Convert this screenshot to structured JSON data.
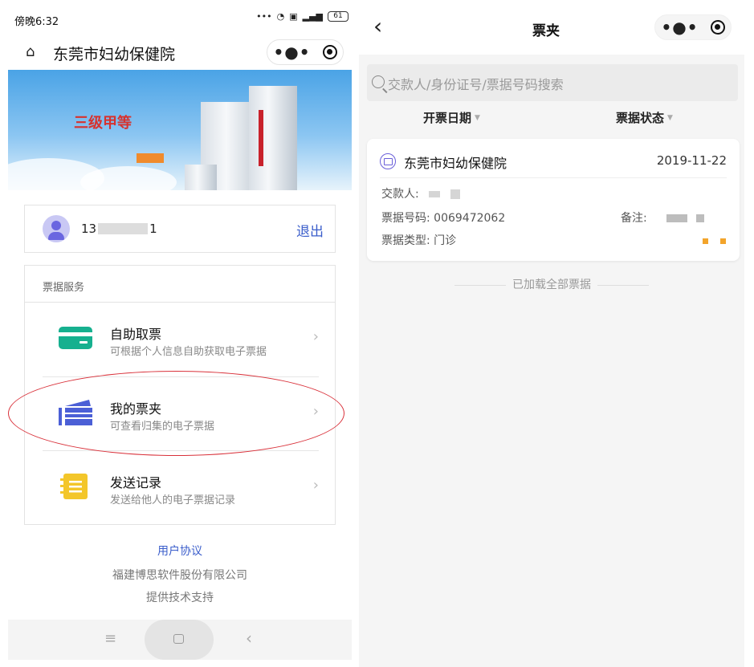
{
  "left": {
    "status": {
      "time": "傍晚6:32",
      "battery": "61"
    },
    "nav": {
      "title": "东莞市妇幼保健院"
    },
    "banner": {
      "grade": "三级甲等"
    },
    "user": {
      "phone_prefix": "13",
      "phone_suffix": "1",
      "logout": "退出"
    },
    "services": {
      "header": "票据服务",
      "items": [
        {
          "title": "自助取票",
          "subtitle": "可根据个人信息自助获取电子票据"
        },
        {
          "title": "我的票夹",
          "subtitle": "可查看归集的电子票据"
        },
        {
          "title": "发送记录",
          "subtitle": "发送给他人的电子票据记录"
        }
      ]
    },
    "footer": {
      "agreement": "用户协议",
      "company": "福建博思软件股份有限公司",
      "support": "提供技术支持"
    }
  },
  "right": {
    "nav": {
      "title": "票夹"
    },
    "search": {
      "placeholder": "交款人/身份证号/票据号码搜索"
    },
    "filters": {
      "date": "开票日期",
      "status": "票据状态"
    },
    "ticket": {
      "org": "东莞市妇幼保健院",
      "date": "2019-11-22",
      "payer_label": "交款人:",
      "number_label": "票据号码:",
      "number": "0069472062",
      "remark_label": "备注:",
      "type_label": "票据类型:",
      "type": "门诊"
    },
    "end_text": "已加载全部票据"
  },
  "colors": {
    "accent_blue": "#3b5ecb",
    "green": "#16b08f",
    "indigo": "#4b5fd6",
    "yellow": "#f3c62a",
    "annotation_red": "#d9313a"
  }
}
